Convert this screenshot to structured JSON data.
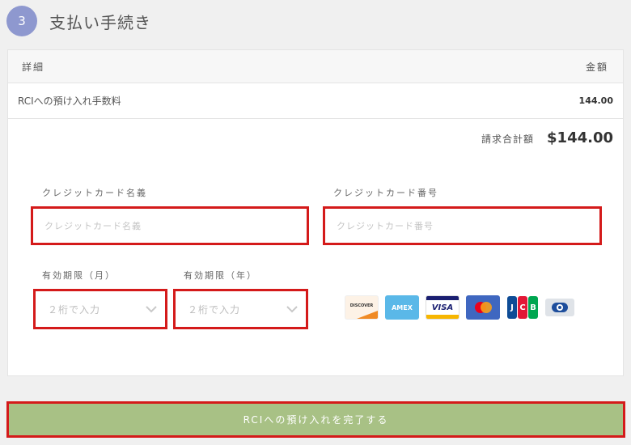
{
  "step": {
    "number": "3",
    "title": "支払い手続き"
  },
  "table": {
    "header": {
      "detail": "詳細",
      "amount": "金額"
    },
    "rows": [
      {
        "label": "RCIへの預け入れ手数料",
        "amount": "144.00"
      }
    ]
  },
  "total": {
    "label": "請求合計額",
    "value": "$144.00"
  },
  "form": {
    "card_name": {
      "label": "クレジットカード名義",
      "placeholder": "クレジットカード名義",
      "value": ""
    },
    "card_number": {
      "label": "クレジットカード番号",
      "placeholder": "クレジットカード番号",
      "value": ""
    },
    "exp_month": {
      "label": "有効期限（月）",
      "placeholder": "２桁で入力"
    },
    "exp_year": {
      "label": "有効期限（年）",
      "placeholder": "２桁で入力"
    }
  },
  "cards": [
    {
      "name": "discover",
      "text": "DISCOVER"
    },
    {
      "name": "amex",
      "text": "AMEX"
    },
    {
      "name": "visa",
      "text": "VISA"
    },
    {
      "name": "mastercard",
      "text": ""
    },
    {
      "name": "jcb",
      "text": "JCB"
    },
    {
      "name": "diners",
      "text": ""
    }
  ],
  "submit": {
    "label": "RCIへの預け入れを完了する"
  },
  "colors": {
    "step_circle": "#8e98cf",
    "submit_bg": "#a8c185",
    "highlight_border": "#d41a1a"
  }
}
